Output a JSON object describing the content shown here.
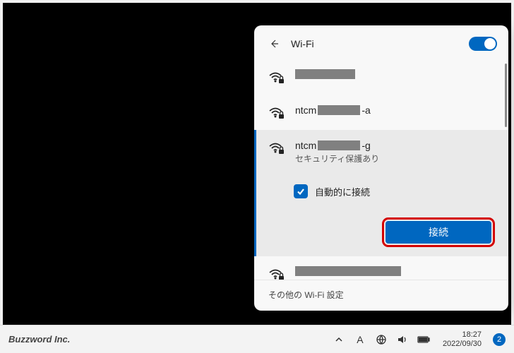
{
  "panel": {
    "title": "Wi-Fi",
    "toggle_on": true,
    "footer_link": "その他の Wi-Fi 設定"
  },
  "networks": [
    {
      "name_prefix": "",
      "redacted_width": "w80",
      "secured": true,
      "selected": false
    },
    {
      "name_prefix": "ntcm",
      "name_suffix": "-a",
      "redacted_width": "w60",
      "secured": true,
      "selected": false
    },
    {
      "name_prefix": "ntcm",
      "name_suffix": "-g",
      "redacted_width": "w60",
      "secured": true,
      "selected": true,
      "security_label": "セキュリティ保護あり"
    },
    {
      "name_prefix": "",
      "redacted_width": "w150",
      "secured": true,
      "selected": false
    }
  ],
  "selected_detail": {
    "auto_connect_label": "自動的に接続",
    "auto_connect_checked": true,
    "connect_button": "接続"
  },
  "taskbar": {
    "brand": "Buzzword Inc.",
    "ime": "A",
    "time": "18:27",
    "date": "2022/09/30",
    "notif_count": "2"
  }
}
